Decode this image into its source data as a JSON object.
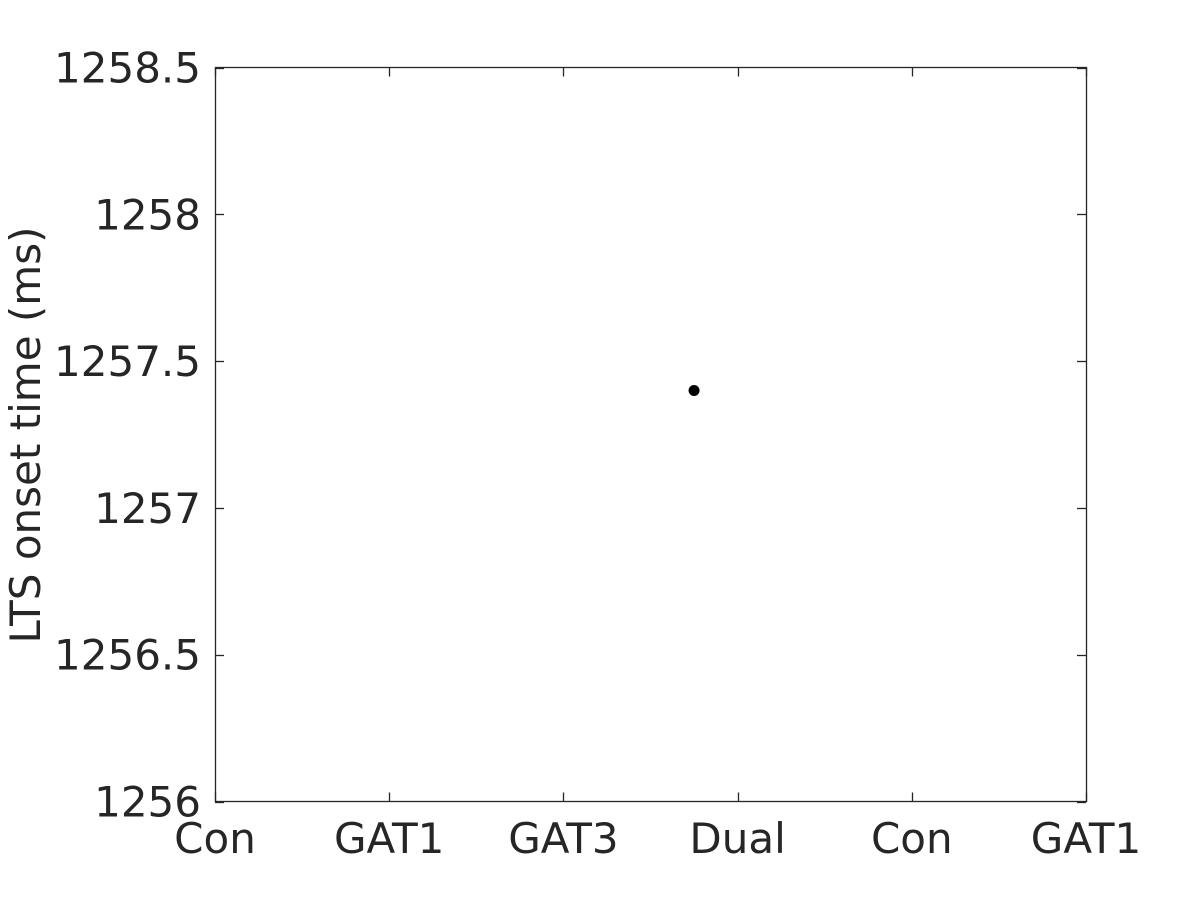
{
  "chart_data": {
    "type": "scatter",
    "title": "",
    "xlabel": "",
    "ylabel": "LTS onset time (ms)",
    "x_tick_labels": [
      "Con",
      "GAT1",
      "GAT3",
      "Dual",
      "Con",
      "GAT1"
    ],
    "x_ticks": [
      1,
      2,
      3,
      4,
      5,
      6
    ],
    "xlim": [
      1,
      6
    ],
    "y_tick_labels": [
      "1256",
      "1256.5",
      "1257",
      "1257.5",
      "1258",
      "1258.5"
    ],
    "y_ticks": [
      1256,
      1256.5,
      1257,
      1257.5,
      1258,
      1258.5
    ],
    "ylim": [
      1256,
      1258.5
    ],
    "grid": false,
    "series": [
      {
        "name": "data",
        "color": "#000000",
        "points": [
          {
            "x": 3.75,
            "y": 1257.4
          }
        ]
      }
    ],
    "colors": {
      "axis": "#262626",
      "text": "#262626",
      "marker": "#000000"
    }
  }
}
